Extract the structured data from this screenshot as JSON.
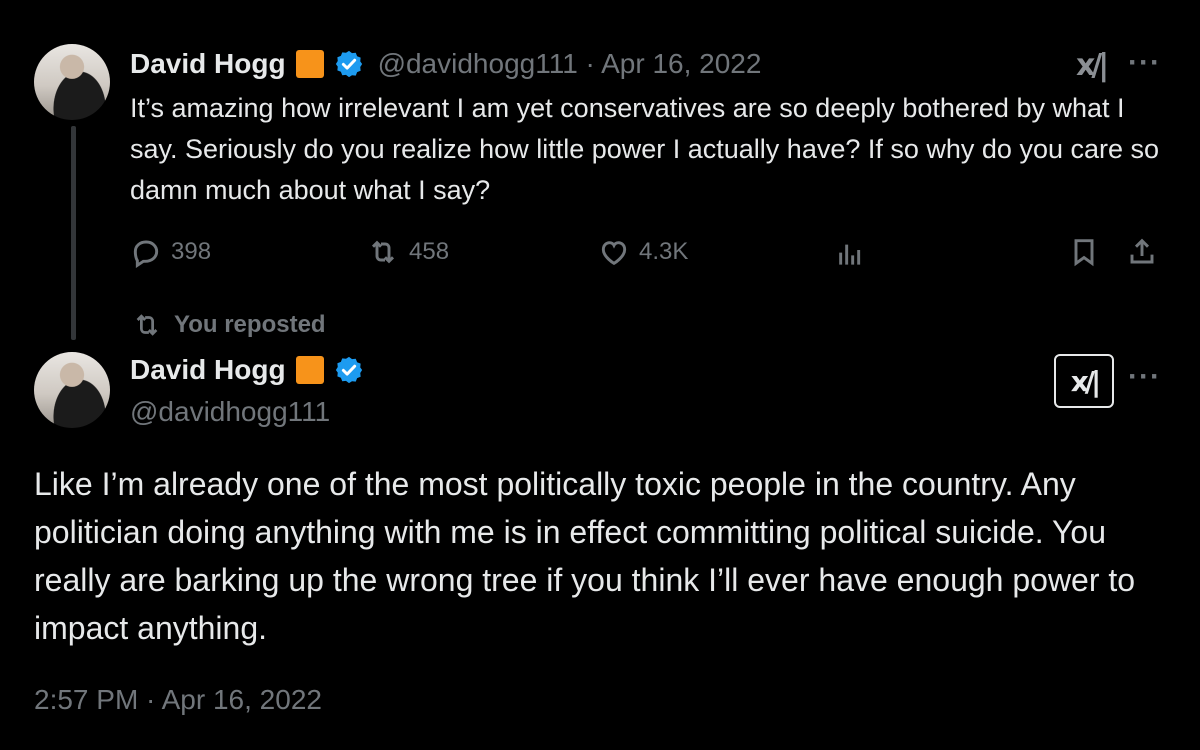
{
  "quoted_tweet": {
    "author_name": "David Hogg",
    "handle_date": "@davidhogg111 · Apr 16, 2022",
    "text": "It’s amazing how irrelevant I am yet conservatives are so deeply bothered by what I say. Seriously do you realize how little power I actually have? If so why do you care so damn much about what I say?",
    "replies": "398",
    "reposts": "458",
    "likes": "4.3K",
    "xai_glyph": "x/|",
    "more_glyph": "···"
  },
  "repost_label": "You reposted",
  "main_tweet": {
    "author_name": "David Hogg",
    "handle": "@davidhogg111",
    "text": "Like I’m already one of the most politically toxic people in the country. Any politician doing anything with me is in effect committing political suicide. You really are barking up the wrong tree if you think I’ll ever have enough power to impact anything.",
    "timestamp": "2:57 PM · Apr 16, 2022",
    "xai_glyph": "x/|",
    "more_glyph": "···"
  },
  "colors": {
    "background": "#000000",
    "text": "#e7e9ea",
    "muted": "#71767b",
    "verified": "#1d9bf0",
    "flag": "#f7931a"
  },
  "icons": [
    "reply-icon",
    "repost-icon",
    "like-icon",
    "views-icon",
    "bookmark-icon",
    "share-icon",
    "verified-badge-icon",
    "flag-emoji-icon",
    "xai-logo-icon",
    "more-icon"
  ]
}
